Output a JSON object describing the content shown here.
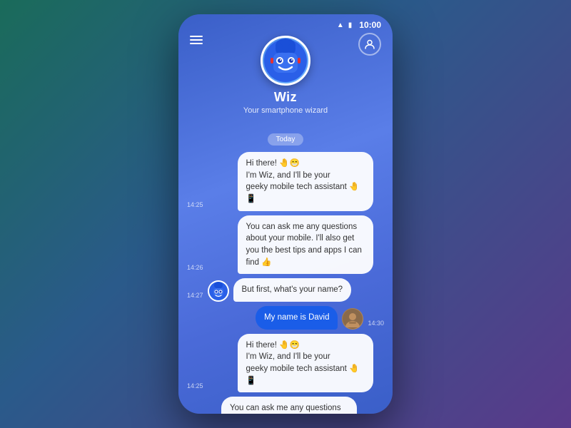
{
  "statusBar": {
    "time": "10:00",
    "signal": "▲",
    "battery": "🔋"
  },
  "header": {
    "hamburger_label": "≡",
    "botName": "Wiz",
    "botSubtitle": "Your smartphone wizard",
    "profileIcon": "👤"
  },
  "chat": {
    "dateSeparator": "Today",
    "messages": [
      {
        "id": 1,
        "sender": "bot",
        "time": "14:25",
        "text": "Hi there! 🤚😁\nI'm Wiz, and I'll be your\ngeeky mobile tech assistant 🤚📱",
        "showAvatar": false
      },
      {
        "id": 2,
        "sender": "bot",
        "time": "14:26",
        "text": "You can ask me any questions about your mobile. I'll also get you the best tips and apps I can find 👍",
        "showAvatar": false
      },
      {
        "id": 3,
        "sender": "bot",
        "time": "14:27",
        "text": "But first, what's your name?",
        "showAvatar": true
      },
      {
        "id": 4,
        "sender": "user",
        "time": "14:30",
        "text": "My name is David",
        "showAvatar": true
      },
      {
        "id": 5,
        "sender": "bot",
        "time": "14:25",
        "text": "Hi there! 🤚😁\nI'm Wiz, and I'll be your\ngeeky mobile tech assistant 🤚📱",
        "showAvatar": false
      },
      {
        "id": 6,
        "sender": "bot",
        "time": "",
        "text": "You can ask me any questions about",
        "showAvatar": false,
        "partial": true
      }
    ]
  }
}
